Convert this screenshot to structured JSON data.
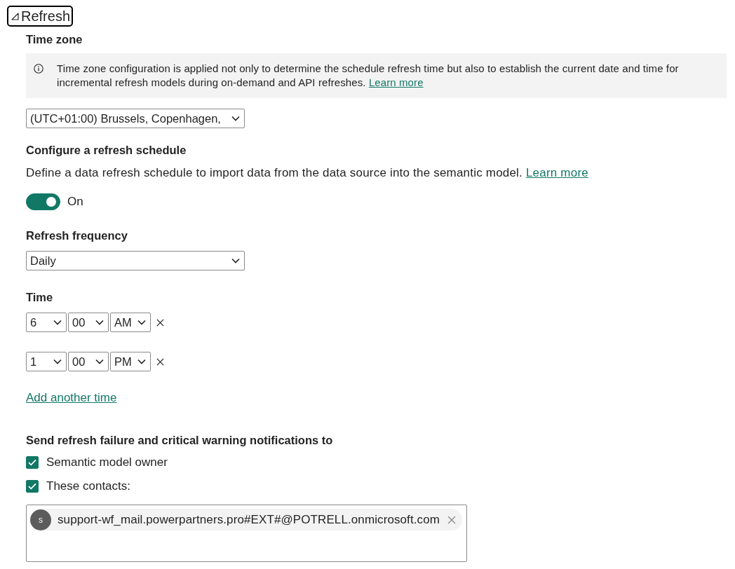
{
  "section": {
    "title": "Refresh",
    "expanded": true
  },
  "time_zone": {
    "label": "Time zone",
    "info": {
      "text": "Time zone configuration is applied not only to determine the schedule refresh time but also to establish the current date and time for incremental refresh models during on-demand and API refreshes.",
      "link": "Learn more"
    },
    "select": {
      "value": "(UTC+01:00) Brussels, Copenhagen,"
    }
  },
  "schedule": {
    "title": "Configure a refresh schedule",
    "description": "Define a data refresh schedule to import data from the data source into the semantic model.",
    "link": "Learn more",
    "toggle": {
      "on": true,
      "label": "On"
    }
  },
  "frequency": {
    "label": "Refresh frequency",
    "value": "Daily"
  },
  "time": {
    "label": "Time",
    "rows": [
      {
        "hour": "6",
        "minute": "00",
        "period": "AM"
      },
      {
        "hour": "1",
        "minute": "00",
        "period": "PM"
      }
    ],
    "add_link": "Add another time"
  },
  "notifications": {
    "title": "Send refresh failure and critical warning notifications to",
    "options": [
      {
        "label": "Semantic model owner",
        "checked": true
      },
      {
        "label": "These contacts:",
        "checked": true
      }
    ],
    "contacts": [
      {
        "initial": "s",
        "email": "support-wf_mail.powerpartners.pro#EXT#@POTRELL.onmicrosoft.com"
      }
    ]
  }
}
